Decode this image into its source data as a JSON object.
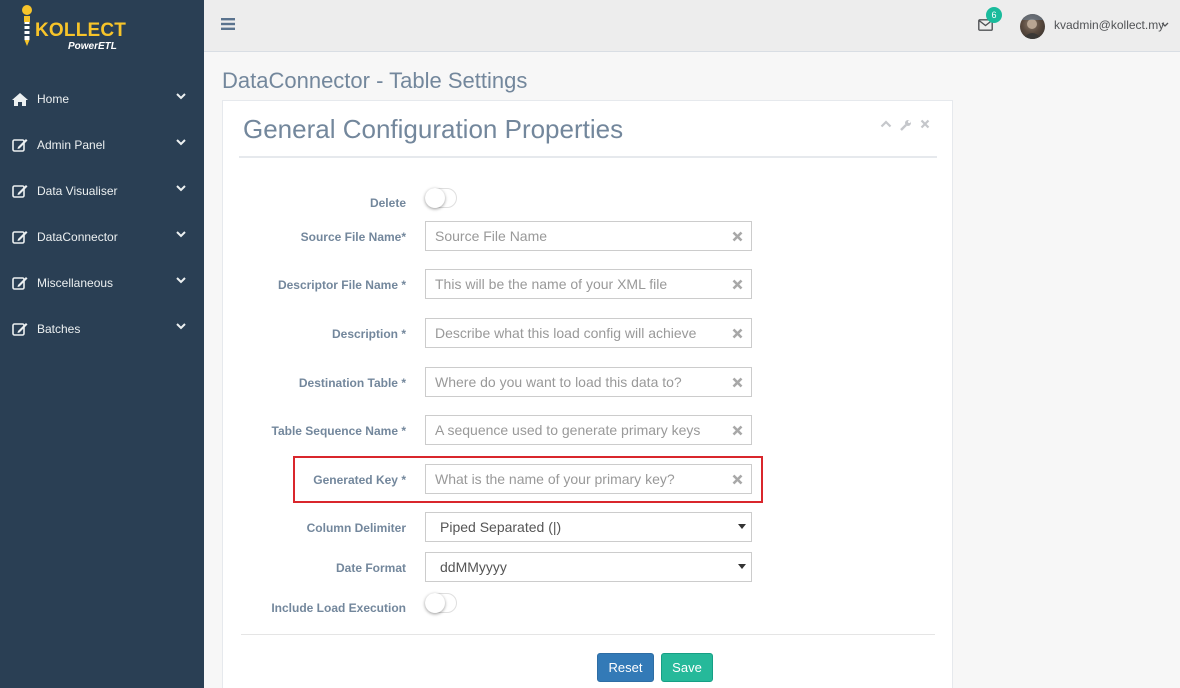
{
  "brand": {
    "name": "KOLLECT",
    "tagline": "PowerETL",
    "accent": "#F7C42A"
  },
  "sidebar": {
    "items": [
      {
        "label": "Home",
        "icon": "home-icon"
      },
      {
        "label": "Admin Panel",
        "icon": "edit-icon"
      },
      {
        "label": "Data Visualiser",
        "icon": "edit-icon"
      },
      {
        "label": "DataConnector",
        "icon": "edit-icon"
      },
      {
        "label": "Miscellaneous",
        "icon": "edit-icon"
      },
      {
        "label": "Batches",
        "icon": "edit-icon"
      }
    ]
  },
  "topbar": {
    "notifications_count": "6",
    "user": "kvadmin@kollect.my"
  },
  "page": {
    "title": "DataConnector - Table Settings"
  },
  "panel": {
    "title": "General Configuration Properties",
    "fields": {
      "delete": {
        "label": "Delete"
      },
      "source_file_name": {
        "label": "Source File Name*",
        "placeholder": "Source File Name"
      },
      "descriptor_file_name": {
        "label": "Descriptor File Name *",
        "placeholder": "This will be the name of your XML file"
      },
      "description": {
        "label": "Description *",
        "placeholder": "Describe what this load config will achieve"
      },
      "destination_table": {
        "label": "Destination Table *",
        "placeholder": "Where do you want to load this data to?"
      },
      "table_sequence_name": {
        "label": "Table Sequence Name *",
        "placeholder": "A sequence used to generate primary keys"
      },
      "generated_key": {
        "label": "Generated Key *",
        "placeholder": "What is the name of your primary key?"
      },
      "column_delimiter": {
        "label": "Column Delimiter",
        "value": "Piped Separated (|)"
      },
      "date_format": {
        "label": "Date Format",
        "value": "ddMMyyyy"
      },
      "include_load_execution": {
        "label": "Include Load Execution"
      }
    },
    "buttons": {
      "reset": "Reset",
      "save": "Save"
    }
  },
  "colors": {
    "sidebar": "#2A3F54",
    "primary": "#337AB7",
    "success": "#26B99A",
    "highlight": "#D9262C"
  }
}
